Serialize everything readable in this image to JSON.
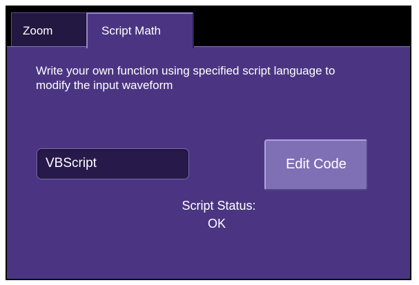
{
  "tabs": [
    {
      "label": "Zoom",
      "active": false
    },
    {
      "label": "Script Math",
      "active": true
    }
  ],
  "panel": {
    "description": "Write your own function using specified script language to modify the input waveform",
    "script_language": "VBScript",
    "edit_button_label": "Edit Code",
    "status_label": "Script Status:",
    "status_value": "OK"
  },
  "colors": {
    "panel_background": "#4b3583",
    "inactive_tab": "#231842",
    "field_background": "#271a4a",
    "button_background": "#7f70b6",
    "text": "#ffffff"
  }
}
